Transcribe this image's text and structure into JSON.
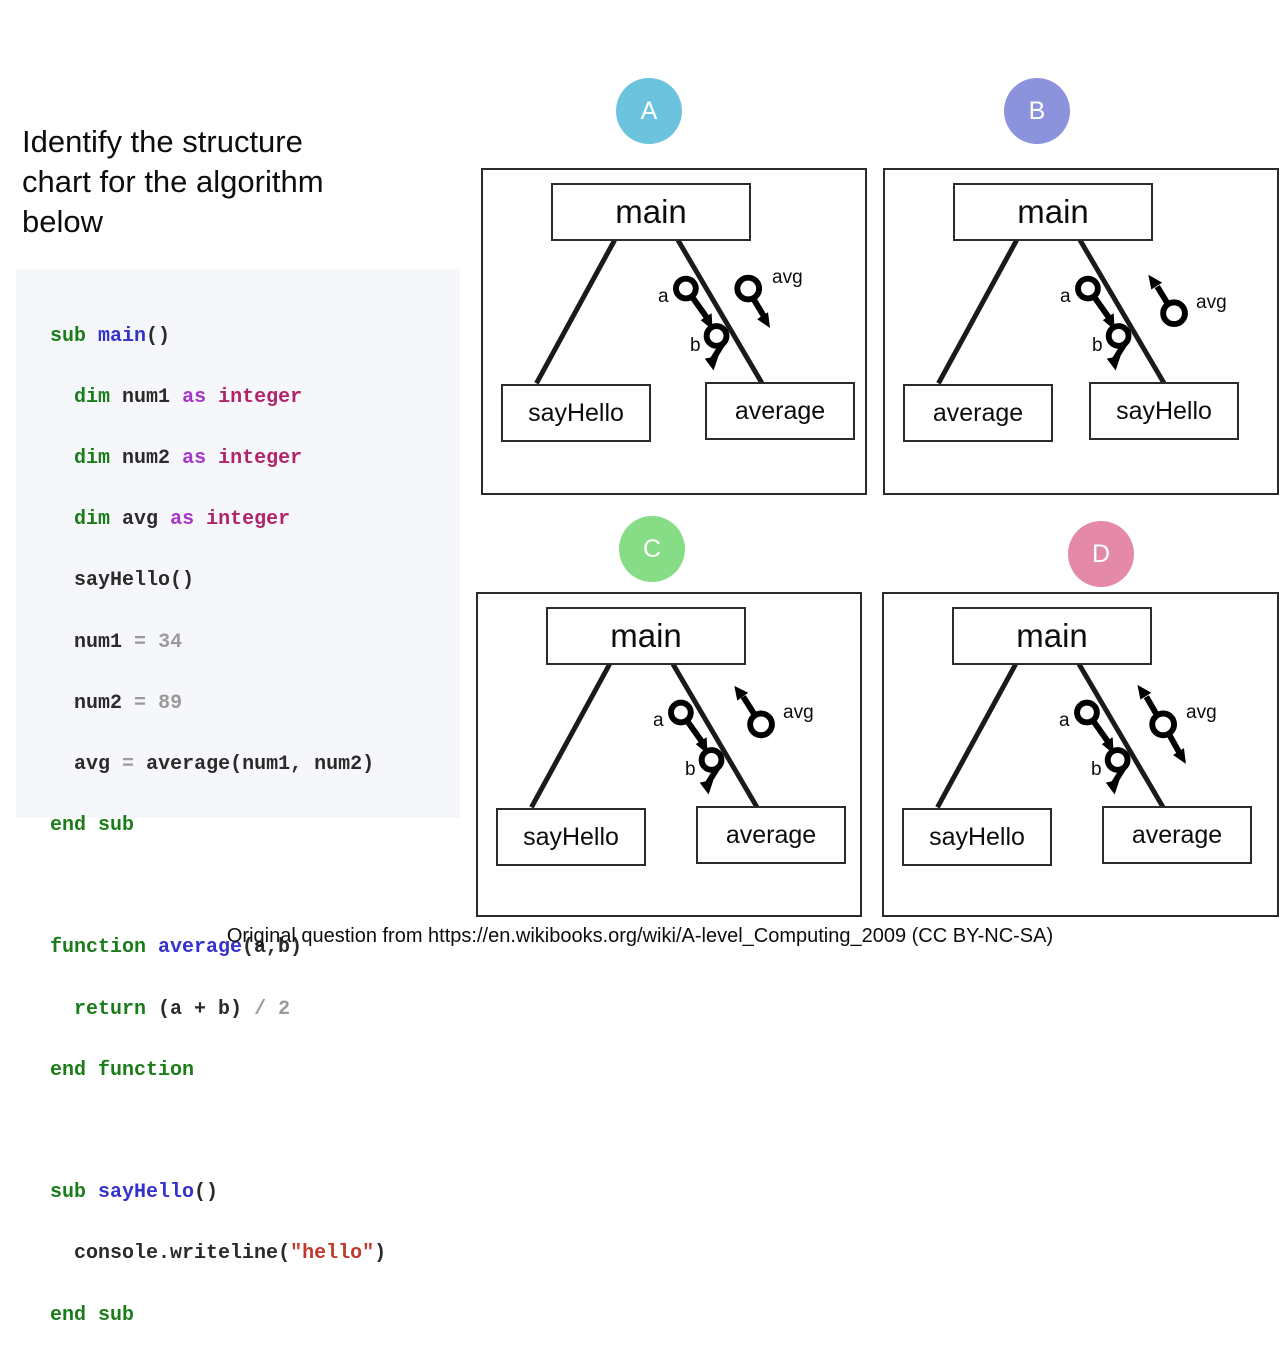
{
  "question": {
    "title": "Identify the structure\nchart for the algorithm\nbelow"
  },
  "code": {
    "lines": [
      "sub main()",
      "  dim num1 as integer",
      "  dim num2 as integer",
      "  dim avg as integer",
      "  sayHello()",
      "  num1 = 34",
      "  num2 = 89",
      "  avg = average(num1, num2)",
      "end sub",
      "",
      "function average(a,b)",
      "  return (a + b) / 2",
      "end function",
      "",
      "sub sayHello()",
      "  console.writeline(\"hello\")",
      "end sub"
    ],
    "tokens": {
      "sub": "sub",
      "end_sub": "end sub",
      "dim": "dim",
      "as": "as",
      "integer": "integer",
      "function": "function",
      "end_function": "end function",
      "return": "return",
      "main": "main",
      "average": "average",
      "sayHello": "sayHello",
      "num1": "num1",
      "num2": "num2",
      "avg": "avg",
      "console_writeline": "console.writeline",
      "hello_string": "\"hello\"",
      "n34": "34",
      "n89": "89",
      "n2": "2"
    },
    "background": "#f5f7fa"
  },
  "options": [
    {
      "id": "A",
      "letter": "A",
      "color": "#6cc3de",
      "nodes": {
        "root": "main",
        "left": "sayHello",
        "right": "average"
      },
      "couples": [
        {
          "label": "a",
          "direction": "down"
        },
        {
          "label": "b",
          "direction": "down"
        },
        {
          "label": "avg",
          "direction": "down"
        }
      ]
    },
    {
      "id": "B",
      "letter": "B",
      "color": "#8b93dd",
      "nodes": {
        "root": "main",
        "left": "average",
        "right": "sayHello"
      },
      "couples": [
        {
          "label": "a",
          "direction": "down"
        },
        {
          "label": "b",
          "direction": "down"
        },
        {
          "label": "avg",
          "direction": "up"
        }
      ]
    },
    {
      "id": "C",
      "letter": "C",
      "color": "#87dd86",
      "nodes": {
        "root": "main",
        "left": "sayHello",
        "right": "average"
      },
      "couples": [
        {
          "label": "a",
          "direction": "down"
        },
        {
          "label": "b",
          "direction": "down"
        },
        {
          "label": "avg",
          "direction": "up"
        }
      ]
    },
    {
      "id": "D",
      "letter": "D",
      "color": "#e489a7",
      "nodes": {
        "root": "main",
        "left": "sayHello",
        "right": "average"
      },
      "couples": [
        {
          "label": "a",
          "direction": "down"
        },
        {
          "label": "b",
          "direction": "down"
        },
        {
          "label": "avg",
          "direction": "both"
        }
      ]
    }
  ],
  "footer": {
    "caption": "Original question from https://en.wikibooks.org/wiki/A-level_Computing_2009 (CC BY-NC-SA)"
  }
}
